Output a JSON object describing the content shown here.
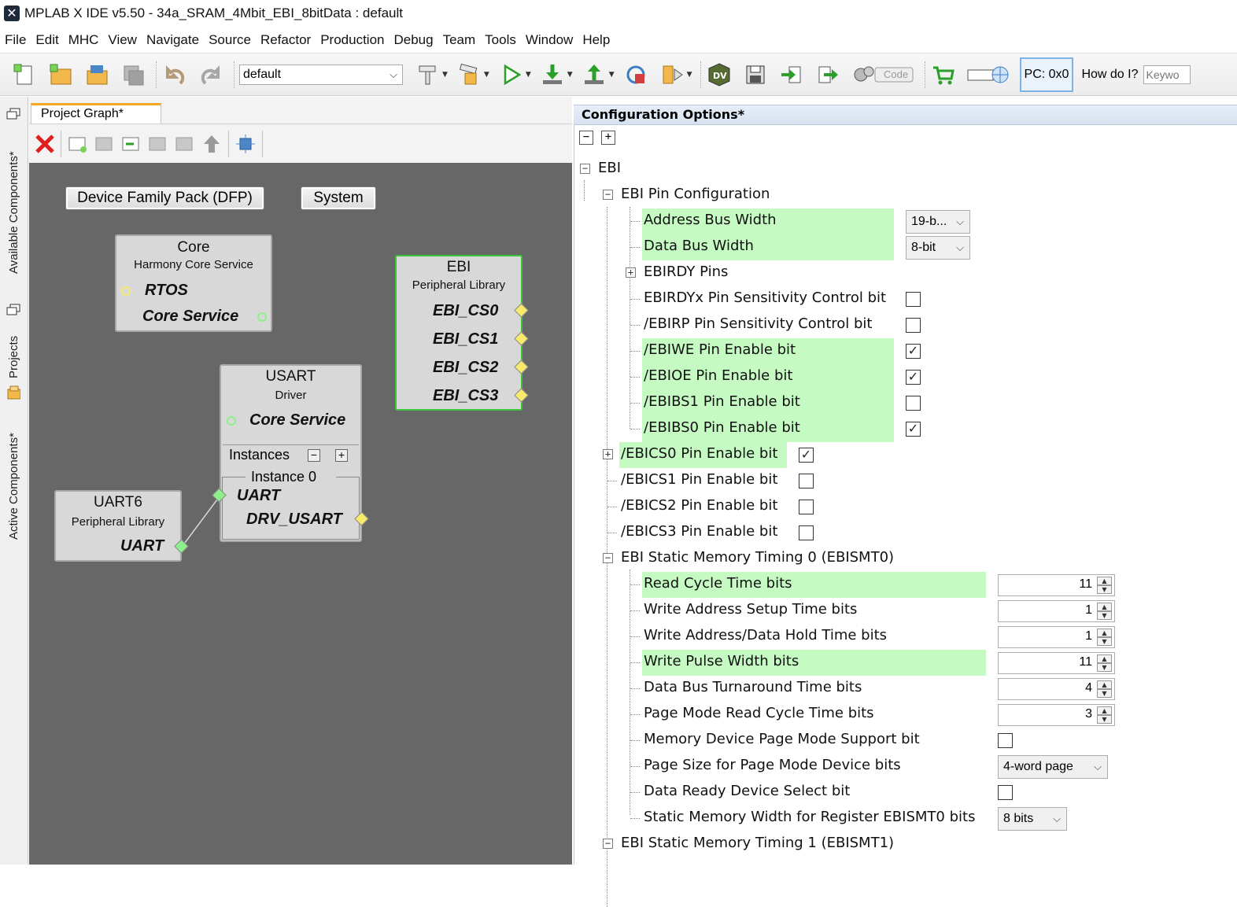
{
  "window": {
    "title": "MPLAB X IDE v5.50 - 34a_SRAM_4Mbit_EBI_8bitData : default"
  },
  "menu": [
    "File",
    "Edit",
    "MHC",
    "View",
    "Navigate",
    "Source",
    "Refactor",
    "Production",
    "Debug",
    "Team",
    "Tools",
    "Window",
    "Help"
  ],
  "toolbar": {
    "config_value": "default",
    "code_label": "Code",
    "pc_label": "PC: 0x0",
    "howdo_label": "How do I?",
    "search_placeholder": "Keywo"
  },
  "side_tabs": {
    "available": "Available Components*",
    "projects": "Projects",
    "active": "Active Components*"
  },
  "graph": {
    "tab_label": "Project Graph*",
    "groups": {
      "dfp": "Device Family Pack (DFP)",
      "system": "System"
    },
    "core": {
      "title": "Core",
      "subtitle": "Harmony Core Service",
      "port_rtos": "RTOS",
      "port_core": "Core Service"
    },
    "ebi": {
      "title": "EBI",
      "subtitle": "Peripheral Library",
      "ports": [
        "EBI_CS0",
        "EBI_CS1",
        "EBI_CS2",
        "EBI_CS3"
      ]
    },
    "usart": {
      "title": "USART",
      "subtitle": "Driver",
      "port_core": "Core Service",
      "instances": "Instances",
      "instance0": "Instance 0",
      "port_uart": "UART",
      "port_drv": "DRV_USART"
    },
    "uart6": {
      "title": "UART6",
      "subtitle": "Peripheral Library",
      "port_uart": "UART"
    },
    "colors": {
      "selected_border": "#3cc43c",
      "canvas": "#676767",
      "port_yellow": "#f7e96a",
      "port_green": "#8ef08a"
    }
  },
  "config": {
    "header": "Configuration Options*",
    "highlight_color": "#c5fbc3",
    "ebi": "EBI",
    "pin_config": "EBI Pin Configuration",
    "address_bus_width": {
      "label": "Address Bus Width",
      "value": "19-b..."
    },
    "data_bus_width": {
      "label": "Data Bus Width",
      "value": "8-bit"
    },
    "ebirdy_pins": "EBIRDY Pins",
    "pin_checks": [
      {
        "label": "EBIRDYx Pin Sensitivity Control bit",
        "checked": false,
        "highlight": false
      },
      {
        "label": "/EBIRP Pin Sensitivity Control bit",
        "checked": false,
        "highlight": false
      },
      {
        "label": "/EBIWE Pin Enable bit",
        "checked": true,
        "highlight": true
      },
      {
        "label": "/EBIOE Pin Enable bit",
        "checked": true,
        "highlight": true
      },
      {
        "label": "/EBIBS1 Pin Enable bit",
        "checked": false,
        "highlight": true
      },
      {
        "label": "/EBIBS0 Pin Enable bit",
        "checked": true,
        "highlight": true
      }
    ],
    "cs_checks": [
      {
        "label": "/EBICS0 Pin Enable bit",
        "checked": true,
        "highlight": true,
        "expandable": true
      },
      {
        "label": "/EBICS1 Pin Enable bit",
        "checked": false,
        "highlight": false,
        "expandable": false
      },
      {
        "label": "/EBICS2 Pin Enable bit",
        "checked": false,
        "highlight": false,
        "expandable": false
      },
      {
        "label": "/EBICS3 Pin Enable bit",
        "checked": false,
        "highlight": false,
        "expandable": false
      }
    ],
    "smt0": "EBI Static Memory Timing 0 (EBISMT0)",
    "smt0_spins": [
      {
        "label": "Read Cycle Time bits",
        "value": "11",
        "highlight": true
      },
      {
        "label": "Write Address Setup Time bits",
        "value": "1",
        "highlight": false
      },
      {
        "label": "Write Address/Data Hold Time bits",
        "value": "1",
        "highlight": false
      },
      {
        "label": "Write Pulse Width bits",
        "value": "11",
        "highlight": true
      },
      {
        "label": "Data Bus Turnaround Time bits",
        "value": "4",
        "highlight": false
      },
      {
        "label": "Page Mode Read Cycle Time bits",
        "value": "3",
        "highlight": false
      }
    ],
    "page_mode_support": {
      "label": "Memory Device Page Mode Support bit",
      "checked": false
    },
    "page_size": {
      "label": "Page Size for Page Mode Device bits",
      "value": "4-word page"
    },
    "data_ready": {
      "label": "Data Ready Device Select bit",
      "checked": false
    },
    "mem_width": {
      "label": "Static Memory Width for Register EBISMT0 bits",
      "value": "8 bits"
    },
    "smt1": "EBI Static Memory Timing 1 (EBISMT1)"
  }
}
